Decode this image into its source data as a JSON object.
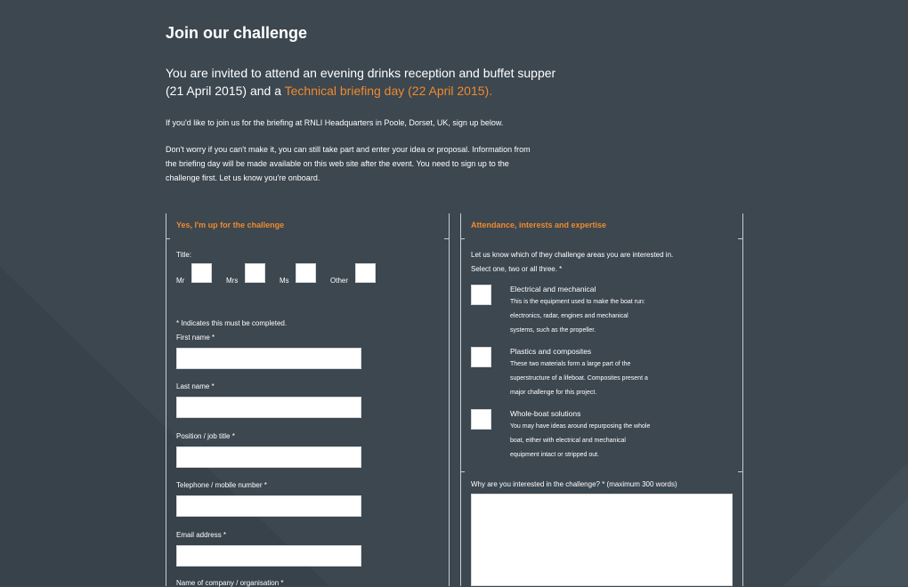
{
  "heading": "Join our challenge",
  "intro": {
    "line1": "You are invited to attend an evening drinks reception and buffet supper",
    "line2_start": "(21 April 2015) and a ",
    "line2_link": "Technical briefing day (22 April 2015)."
  },
  "para1": "If you'd like to join us for the briefing at RNLI Headquarters in Poole, Dorset, UK, sign up below.",
  "para2": {
    "line1": "Don't worry if you can't make it, you can still take part and enter your idea or proposal. Information from",
    "line2": "the briefing day will be made available on this web site after the event. You need to sign up to the",
    "line3": "challenge first. Let us know you're onboard."
  },
  "left_section": {
    "heading": "Yes, I'm up for the challenge",
    "title_label": "Title:",
    "title_options": [
      "Mr",
      "Mrs",
      "Ms",
      "Other"
    ],
    "required_note": "* Indicates this must be completed.",
    "fields": [
      {
        "label": "First name *"
      },
      {
        "label": "Last name *"
      },
      {
        "label": "Position / job title *"
      },
      {
        "label": "Telephone / mobile number *"
      },
      {
        "label": "Email address *"
      },
      {
        "label": "Name of company / organisation *"
      }
    ]
  },
  "right_section": {
    "heading": "Attendance, interests and expertise",
    "intro1": "Let us know which of they challenge areas you are interested in.",
    "intro2": "Select one, two or all three. *",
    "areas": [
      {
        "title": "Electrical and mechanical",
        "desc1": "This is the equipment used to make the boat run:",
        "desc2": "electronics, radar, engines and mechanical",
        "desc3": "systems, such as the propeller."
      },
      {
        "title": "Plastics and composites",
        "desc1": "These two materials form a large part of the",
        "desc2": "superstructure of a lifeboat. Composites present a",
        "desc3": "major challenge for this project."
      },
      {
        "title": "Whole-boat solutions",
        "desc1": "You may have ideas around repurposing the whole",
        "desc2": "boat, either with electrical and mechanical",
        "desc3": "equipment intact or stripped out."
      }
    ],
    "why_label": "Why are you interested in the challenge? * (maximum 300 words)"
  },
  "colors": {
    "background": "#3c4750",
    "accent": "#f08a2c",
    "text": "#ffffff"
  }
}
